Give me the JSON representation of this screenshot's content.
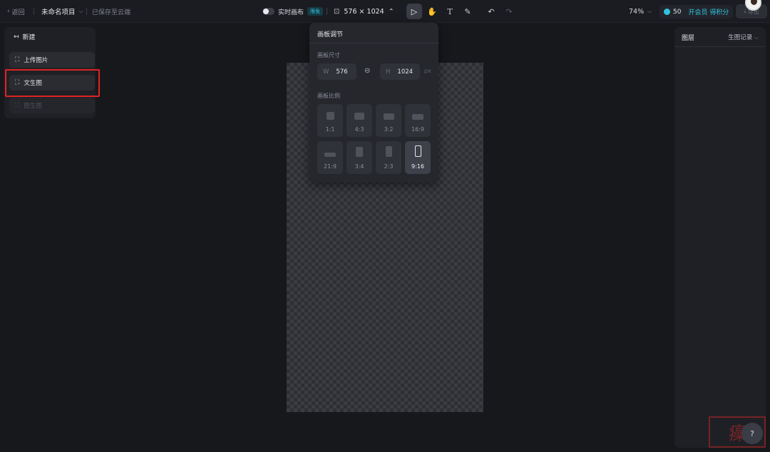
{
  "header": {
    "back_label": "返回",
    "project_name": "未命名项目",
    "saved_status": "已保存至云端",
    "live_canvas_label": "实时画布",
    "free_badge": "限免",
    "canvas_size": "576 × 1024",
    "zoom": "74%",
    "credits": "50",
    "vip_label": "开会员 得积分",
    "export_label": "导出"
  },
  "left_panel": {
    "title": "新建",
    "upload_label": "上传图片",
    "text_to_image_label": "文生图",
    "image_to_image_label": "图生图"
  },
  "popover": {
    "title": "画板调节",
    "size_label": "画板尺寸",
    "width_key": "W",
    "width_value": "576",
    "height_key": "H",
    "height_value": "1024",
    "unit": "px",
    "ratio_label": "画板比例",
    "ratios": [
      "1:1",
      "4:3",
      "3:2",
      "16:9",
      "21:9",
      "3:4",
      "2:3",
      "9:16"
    ],
    "selected_ratio": "9:16"
  },
  "right_panel": {
    "layers_label": "图层",
    "history_label": "生图记录"
  },
  "help_label": "?",
  "colors": {
    "accent": "#33c3dd",
    "highlight": "#e02323",
    "background": "#17181c"
  }
}
